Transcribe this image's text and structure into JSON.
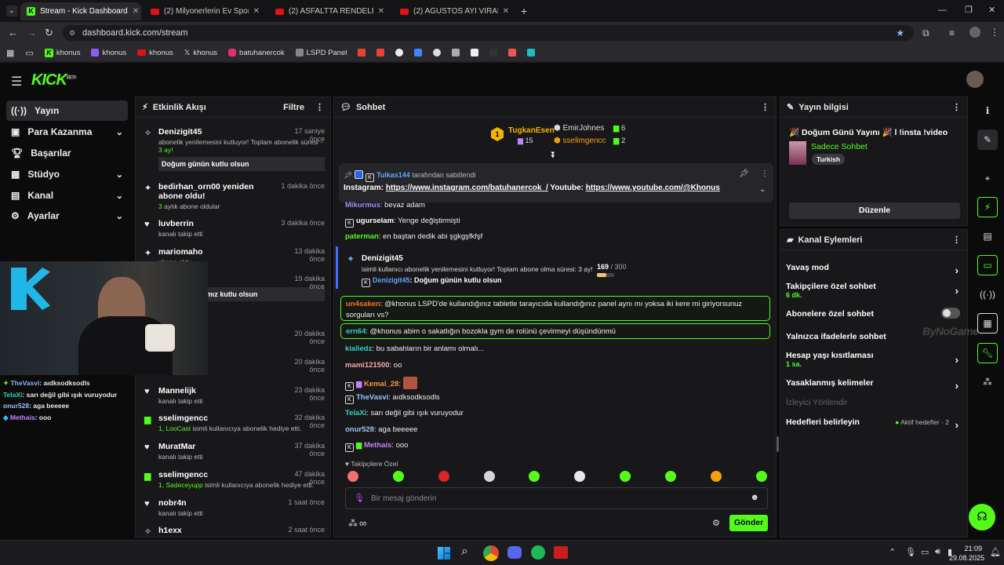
{
  "tabs": [
    {
      "label": "Stream - Kick Dashboard",
      "active": true
    },
    {
      "label": "(2) Milyonerlerin Ev Spor Salonl..."
    },
    {
      "label": "(2) ASFALTTA RENDELENDİ! Tür..."
    },
    {
      "label": "(2) AĞUSTOS AYI VİRAL VİDEOL..."
    }
  ],
  "url": "dashboard.kick.com/stream",
  "bookmarks": [
    "khonus",
    "khonus",
    "khonus",
    "khonus",
    "batuhanercok",
    "LSPD Panel"
  ],
  "brand": {
    "logo": "KICK",
    "beta": "BETA",
    "accent": "#53fc18"
  },
  "sidebar": {
    "items": [
      "Yayın",
      "Para Kazanma",
      "Başarılar",
      "Stüdyo",
      "Kanal",
      "Ayarlar"
    ]
  },
  "activity": {
    "title": "Etkinlik Akışı",
    "filter": "Filtre",
    "events": [
      {
        "name": "Denizigit45",
        "time": "17 saniye önce",
        "desc": "abonelik yenilemesini kutluyor! Toplam abonelik süresi",
        "hi": "- 3 ay!",
        "msg": "Doğum günün kutlu olsun"
      },
      {
        "name": "bedirhan_orn00 yeniden abone oldu!",
        "time": "1 dakika önce",
        "hi": "3",
        "desc": "aylık abone oldular"
      },
      {
        "name": "luvberrin",
        "time": "3 dakika önce",
        "desc": "kanalı takip etti"
      },
      {
        "name": "mariomaho",
        "time": "13 dakika önce",
        "desc": "abone oldu"
      },
      {
        "name": "",
        "time": "19 dakika önce",
        "msg": "...elere. 4. Ayımız kutlu olsun"
      },
      {
        "name": "",
        "time": "20 dakika önce"
      },
      {
        "name": "",
        "time": "20 dakika önce"
      },
      {
        "name": "Mannelijk",
        "time": "23 dakika önce",
        "desc": "kanalı takip etti"
      },
      {
        "name": "sselimgencc",
        "time": "32 dakika önce",
        "hi": "1, LooCast",
        "desc": "isimli kullanıcıya abonelik hediye etti."
      },
      {
        "name": "MuratMar",
        "time": "37 dakika önce",
        "desc": "kanalı takip etti"
      },
      {
        "name": "sselimgencc",
        "time": "47 dakika önce",
        "hi": "1, Sadeceyupp",
        "desc": "isimli kullanıcıya abonelik hediye etti."
      },
      {
        "name": "nobr4n",
        "time": "1 saat önce",
        "desc": "kanalı takip etti"
      },
      {
        "name": "h1exx",
        "time": "2 saat önce"
      }
    ]
  },
  "overlay_chat": [
    {
      "user": "TheVasvi",
      "text": ": aıdksodksodls"
    },
    {
      "user": "TelaXi",
      "text": ": sarı değil gibi ışık vuruyodur"
    },
    {
      "user": "onur528",
      "text": ": aga beeeee"
    },
    {
      "user": "Methais",
      "text": ": ooo"
    }
  ],
  "chat": {
    "title": "Sohbet",
    "top": [
      {
        "name": "TugkanEsen",
        "count": "15"
      },
      {
        "name": "EmirJohnes",
        "count": "6"
      },
      {
        "name": "sselimgencc",
        "count": "2"
      }
    ],
    "pinned_by": "Tulkas144",
    "pinned_suffix": "tarafından sabitlendi",
    "pinned_text": "Instagram: ",
    "pinned_link1": "https://www.instagram.com/batuhanercok_/",
    "pinned_mid": " Youtube: ",
    "pinned_link2": "https://www.youtube.com/@Khonus",
    "lines": [
      {
        "user": "Mikurmus",
        "text": ": beyaz adam"
      },
      {
        "user": "ugurselam",
        "text": ": Yenge değiştirmişti"
      },
      {
        "user": "paterman",
        "text": ": en baştan dedik abi şgkgşfkfşf"
      }
    ],
    "sub_card": {
      "user": "Denizigit45",
      "desc": "isimli kullanıcı abonelik yenilemesini kutluyor! Toplam abone olma süresi: 3 ay!",
      "progress": "169",
      "goal": "/ 300",
      "reply_user": "Denizigit45",
      "reply_text": ": Doğum günün kutlu olsun"
    },
    "hl1": {
      "user": "un4saken",
      "text": ": @khonus LSPD'de kullandığınız tabletle tarayıcıda kullandığınız panel aynı mı yoksa iki kere mi giriyorsunuz sorguları vs?"
    },
    "hl2": {
      "user": "ern64",
      "text": ": @khonus abim o sakatlığın bozokla gym de rolünü çevirmeyi düşündünmü"
    },
    "lines2": [
      {
        "user": "kialiedz",
        "text": ": bu sabahların bir anlamı olmalı..."
      },
      {
        "user": "mami121500",
        "text": ": oo"
      },
      {
        "user": "Kemal_28",
        "text": ":"
      },
      {
        "user": "TheVasvi",
        "text": ": aıdksodksodls"
      },
      {
        "user": "TelaXi",
        "text": ": sarı değil gibi ışık vuruyodur"
      },
      {
        "user": "onur528",
        "text": ": aga beeeee"
      },
      {
        "user": "Methais",
        "text": ": ooo"
      }
    ],
    "followers_only": "Takipçilere Özel",
    "input_placeholder": "Bir mesaj gönderin",
    "send": "Gönder",
    "infinity": "∞"
  },
  "stream_info": {
    "title": "Yayın bilgisi",
    "stream_title": "🎉 Doğum Günü Yayını 🎉 l !insta !video",
    "category": "Sadece Sohbet",
    "tag": "Turkish",
    "edit": "Düzenle"
  },
  "channel_actions": {
    "title": "Kanal Eylemleri",
    "rows": [
      {
        "label": "Yavaş mod"
      },
      {
        "label": "Takipçilere özel sohbet",
        "sub": "6 dk."
      },
      {
        "label": "Abonelere özel sohbet"
      },
      {
        "label": "Yalnızca ifadelerle sohbet"
      },
      {
        "label": "Hesap yaşı kısıtlaması",
        "sub": "1 sa."
      },
      {
        "label": "Yasaklanmış kelimeler"
      },
      {
        "label": "İzleyici Yönlendir"
      },
      {
        "label": "Hedefleri belirleyin",
        "extra": "Aktif hedefler - 2"
      }
    ]
  },
  "watermark": "ByNoGame",
  "clock": {
    "time": "21:09",
    "date": "29.08.2025"
  }
}
